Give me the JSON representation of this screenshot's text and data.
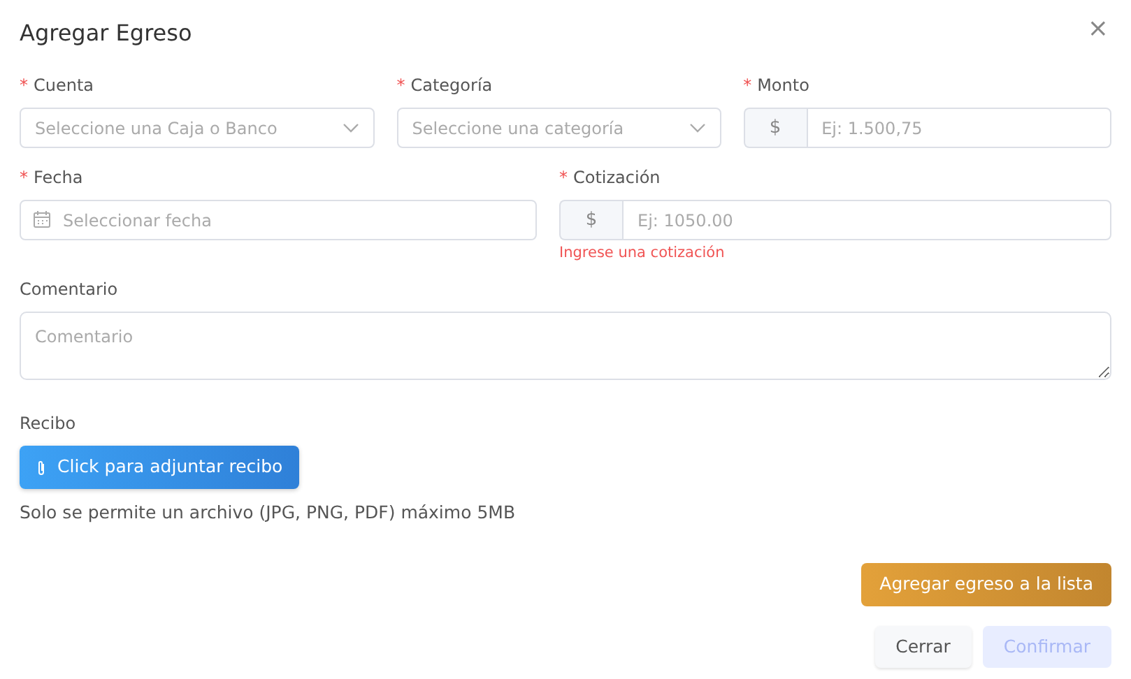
{
  "window": {
    "title": "Agregar Egreso",
    "close": "×"
  },
  "field_rows": [
    [
      {
        "kind": "select",
        "label": "Cuenta",
        "required": true,
        "placeholder": "Seleccione una Caja o Banco"
      },
      {
        "kind": "select",
        "label": "Categoría",
        "required": true,
        "placeholder": "Seleccione una categoría"
      },
      {
        "kind": "money",
        "label": "Monto",
        "required": true,
        "prefix": "$",
        "placeholder": "Ej: 1.500,75"
      }
    ],
    [
      {
        "kind": "date",
        "label": "Fecha",
        "required": true,
        "placeholder": "Seleccionar fecha"
      },
      {
        "kind": "money",
        "label": "Cotización",
        "required": true,
        "prefix": "$",
        "placeholder": "Ej: 1050.00",
        "error": "Ingrese una cotización"
      }
    ]
  ],
  "required_mark": "*",
  "comment": {
    "label": "Comentario",
    "placeholder": "Comentario"
  },
  "receipt": {
    "label": "Recibo",
    "button": "Click para adjuntar recibo",
    "hint": "Solo se permite un archivo (JPG, PNG, PDF) máximo 5MB"
  },
  "add_button": "Agregar egreso a la lista",
  "buttons": [
    {
      "label": "Cerrar",
      "kind": "secondary",
      "disabled": false
    },
    {
      "label": "Confirmar",
      "kind": "primary",
      "disabled": true
    }
  ]
}
